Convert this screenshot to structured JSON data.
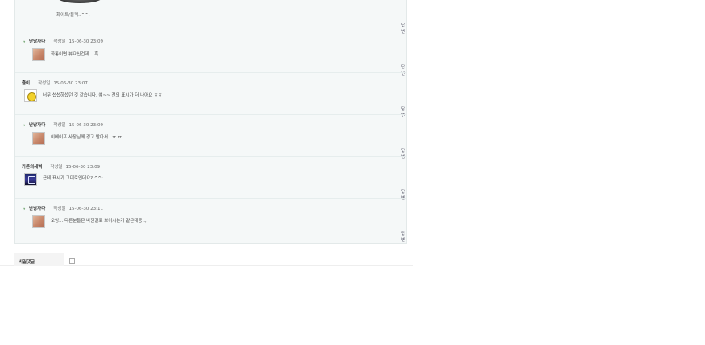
{
  "top_comment_text": "화이트/블랙..^^;",
  "reply_label": "답변",
  "date_label": "작성일",
  "secret_comment_label": "비밀댓글",
  "comments": [
    {
      "author": "난낭자다",
      "date": "15-06-30 23:09",
      "text": "화통이면 뷰요신건데....흑",
      "is_reply": true,
      "avatar_icon": "photo-avatar"
    },
    {
      "author": "줄이",
      "date": "15-06-30 23:07",
      "text": "너무 섭섭하셨던 것 같습니다. 예~~ 전의 표시가 더 나아요 ㅎㅎ",
      "is_reply": false,
      "avatar_icon": "pikachu-avatar"
    },
    {
      "author": "난낭자다",
      "date": "15-06-30 23:09",
      "text": "이베이프 사장님께 경고 받아서...ㅠ ㅠ",
      "is_reply": true,
      "avatar_icon": "photo-avatar"
    },
    {
      "author": "카론의새벽",
      "date": "15-06-30 23:09",
      "text": "근데 표시가 그대로인데요? ^^;",
      "is_reply": false,
      "avatar_icon": "night-avatar"
    },
    {
      "author": "난낭자다",
      "date": "15-06-30 23:11",
      "text": "오잉....다른분들은 바뀐걸로 보이시는거 같은데용..;",
      "is_reply": true,
      "avatar_icon": "photo-avatar"
    }
  ]
}
